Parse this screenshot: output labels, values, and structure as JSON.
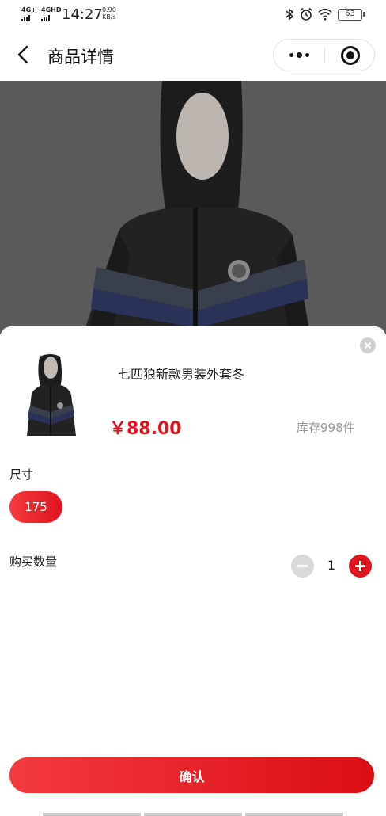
{
  "status_bar": {
    "network_1": "4G+",
    "network_2": "4GHD",
    "time": "14:27",
    "speed_value": "0.90",
    "speed_unit": "KB/s",
    "battery": "63",
    "icons": [
      "bluetooth-icon",
      "alarm-icon",
      "wifi-icon",
      "battery-icon"
    ]
  },
  "nav": {
    "title": "商品详情",
    "icons": [
      "back-icon",
      "more-dots-icon",
      "target-icon"
    ]
  },
  "sheet": {
    "product_title": "七匹狼新款男装外套冬",
    "price": "￥88.00",
    "stock": "库存998件",
    "size_label": "尺寸",
    "size_option": "175",
    "quantity_label": "购买数量",
    "quantity": "1",
    "confirm_label": "确认"
  },
  "colors": {
    "accent": "#e0141e",
    "overlay": "#5a5a5a",
    "muted_text": "#999999"
  }
}
